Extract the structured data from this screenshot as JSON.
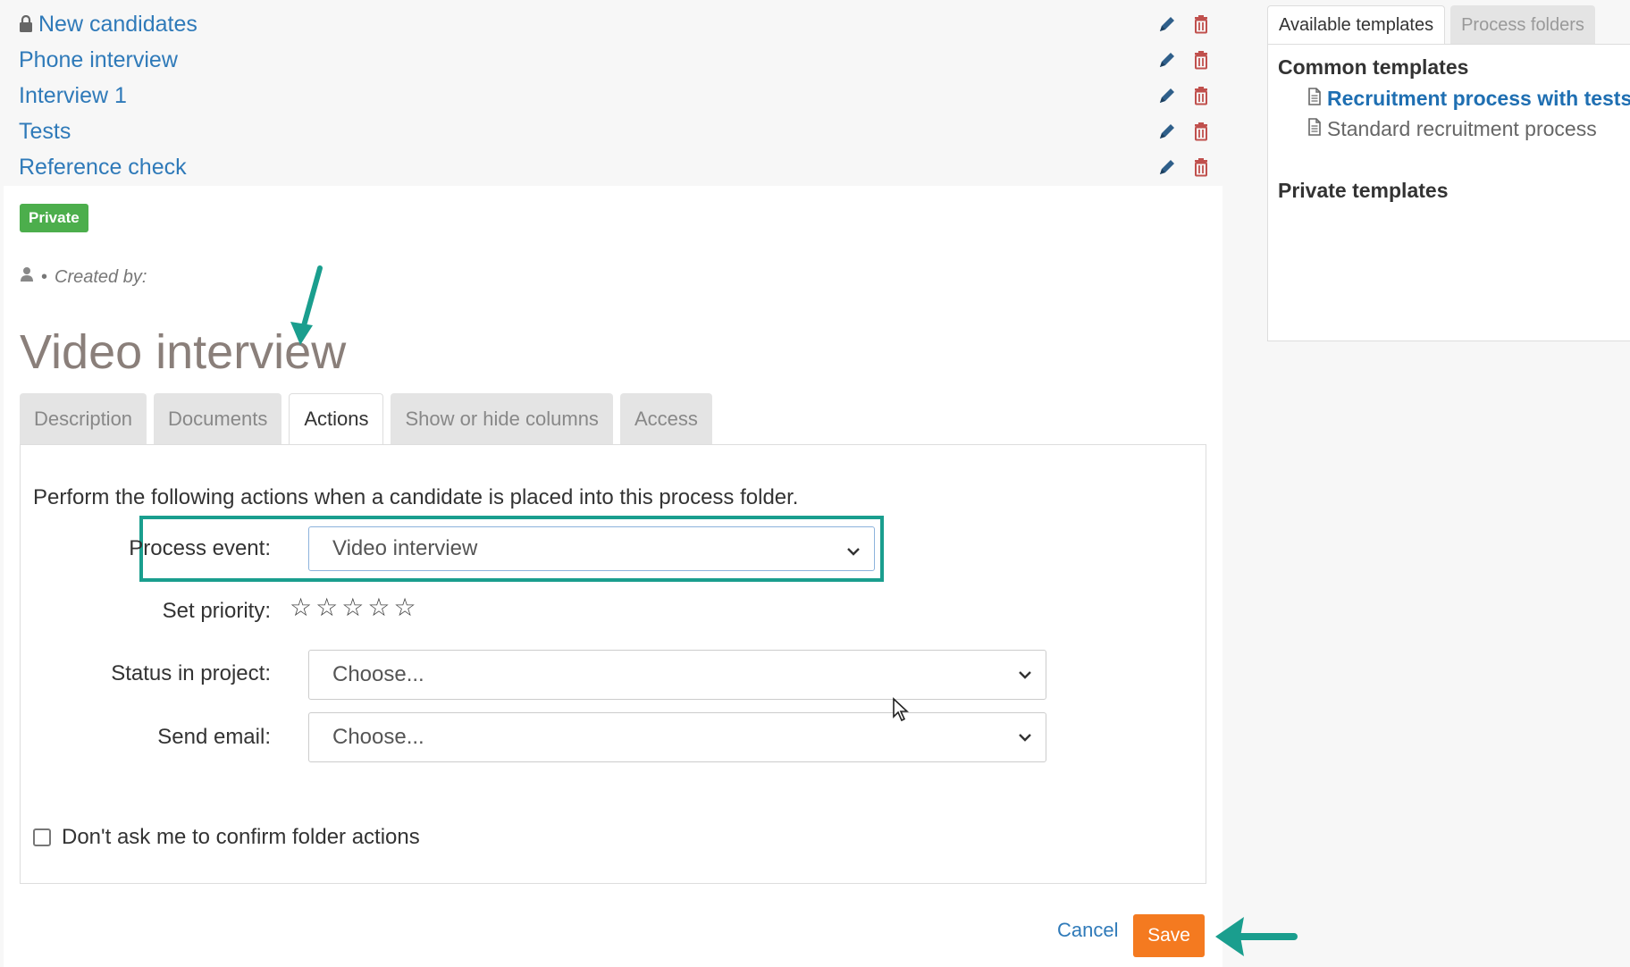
{
  "folders": [
    {
      "label": "New candidates",
      "locked": true
    },
    {
      "label": "Phone interview",
      "locked": false
    },
    {
      "label": "Interview 1",
      "locked": false
    },
    {
      "label": "Tests",
      "locked": false
    },
    {
      "label": "Reference check",
      "locked": false
    }
  ],
  "folder_icons": {
    "edit": "pencil-icon",
    "delete": "trash-icon",
    "lock": "lock-icon"
  },
  "badge": "Private",
  "created_by": "Created by:",
  "title": "Video interview",
  "tabs": [
    "Description",
    "Documents",
    "Actions",
    "Show or hide columns",
    "Access"
  ],
  "active_tab": "Actions",
  "intro": "Perform the following actions when a candidate is placed into this process folder.",
  "form": {
    "process_event_label": "Process event:",
    "process_event_value": "Video interview",
    "priority_label": "Set priority:",
    "priority_stars": 5,
    "priority_value": 0,
    "status_label": "Status in project:",
    "status_value": "Choose...",
    "email_label": "Send email:",
    "email_value": "Choose...",
    "confirm_label": "Don't ask me to confirm folder actions",
    "confirm_checked": false
  },
  "buttons": {
    "cancel": "Cancel",
    "save": "Save"
  },
  "right_panel": {
    "tabs": [
      "Available templates",
      "Process folders"
    ],
    "active_tab": "Available templates",
    "common_heading": "Common templates",
    "common_items": [
      "Recruitment process with tests",
      "Standard recruitment process"
    ],
    "private_heading": "Private templates"
  },
  "colors": {
    "link": "#2f7ab9",
    "badge": "#4cae4c",
    "save": "#f47a20",
    "annotation": "#1a9e8e",
    "trash": "#c0504d"
  }
}
